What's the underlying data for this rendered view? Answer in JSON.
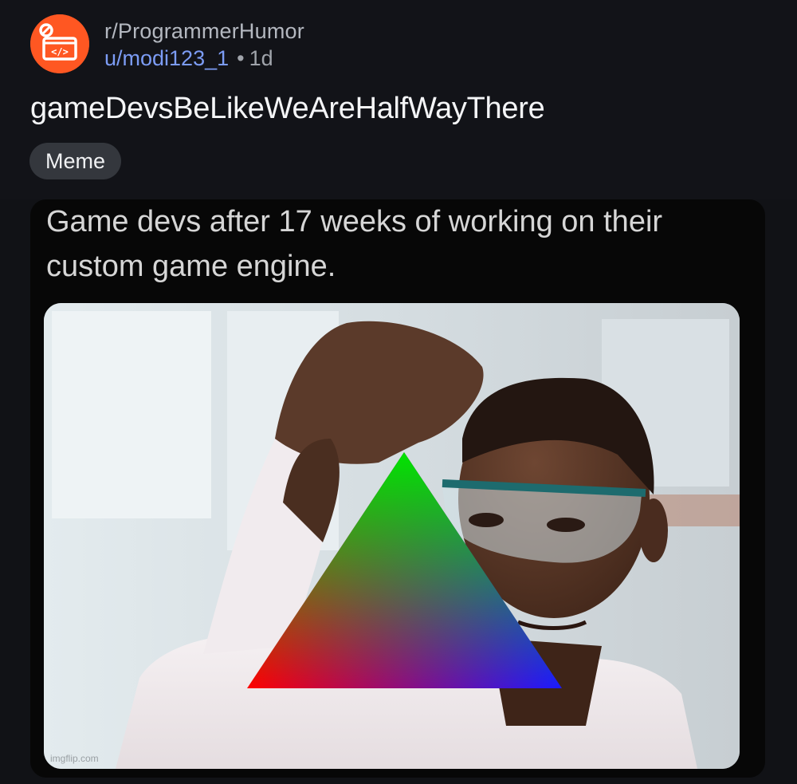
{
  "post": {
    "subreddit": "r/ProgrammerHumor",
    "username": "u/modi123_1",
    "separator": "•",
    "age": "1d",
    "title": "gameDevsBeLikeWeAreHalfWayThere",
    "flair": "Meme",
    "avatar_icon": "code-window-icon",
    "avatar_color": "#ff5722",
    "accent_color": "#7c9cf5"
  },
  "meme": {
    "caption": "Game devs after 17 weeks of working on their custom game engine.",
    "watermark": "imgflip.com",
    "triangle_colors": [
      "#00e400",
      "#ff0000",
      "#1a1aff"
    ]
  }
}
